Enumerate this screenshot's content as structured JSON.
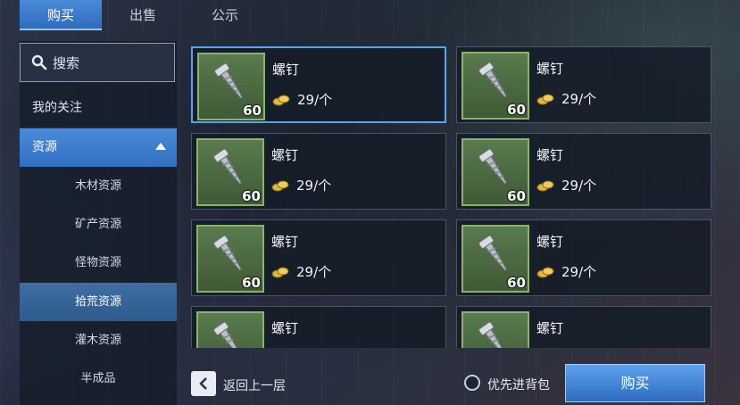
{
  "tabs": [
    {
      "label": "购买",
      "active": true
    },
    {
      "label": "出售",
      "active": false
    },
    {
      "label": "公示",
      "active": false
    }
  ],
  "sidebar": {
    "search_label": "搜索",
    "items": [
      {
        "label": "我的关注"
      },
      {
        "label": "资源"
      },
      {
        "label": "木材资源"
      },
      {
        "label": "矿产资源"
      },
      {
        "label": "怪物资源"
      },
      {
        "label": "拾荒资源"
      },
      {
        "label": "灌木资源"
      },
      {
        "label": "半成品"
      }
    ]
  },
  "items": [
    {
      "name": "螺钉",
      "quantity": "60",
      "price": "29/个",
      "icon": "screw-icon"
    },
    {
      "name": "螺钉",
      "quantity": "60",
      "price": "29/个",
      "icon": "screw-icon"
    },
    {
      "name": "螺钉",
      "quantity": "60",
      "price": "29/个",
      "icon": "screw-icon"
    },
    {
      "name": "螺钉",
      "quantity": "60",
      "price": "29/个",
      "icon": "screw-icon"
    },
    {
      "name": "螺钉",
      "quantity": "60",
      "price": "29/个",
      "icon": "screw-icon"
    },
    {
      "name": "螺钉",
      "quantity": "60",
      "price": "29/个",
      "icon": "screw-icon"
    },
    {
      "name": "螺钉",
      "quantity": "",
      "price": "",
      "icon": "screw-icon"
    },
    {
      "name": "螺钉",
      "quantity": "",
      "price": "",
      "icon": "screw-icon"
    }
  ],
  "bottom": {
    "back_label": "返回上一层",
    "priority_label": "优先进背包",
    "buy_label": "购买"
  },
  "colors": {
    "accent": "#3f84d6",
    "selected_border": "#5aa3ee",
    "item_frame": "#8bb36b",
    "coin": "#e2b845"
  }
}
